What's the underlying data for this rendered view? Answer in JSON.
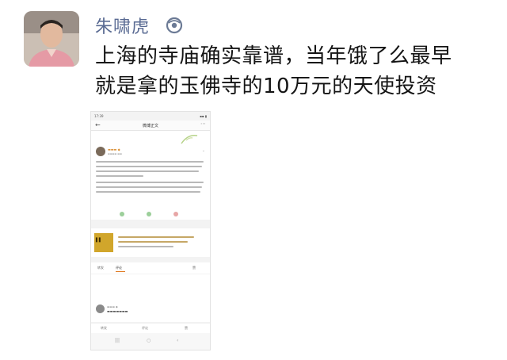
{
  "post": {
    "author": "朱啸虎",
    "lines": [
      "上海的寺庙确实靠谱，当年饿了么最早",
      "就是拿的玉佛寺的10万元的天使投资"
    ]
  },
  "embedded_screenshot": {
    "status_time": "17:39",
    "nav_title": "微博正文",
    "toolbar": [
      "转发",
      "评论",
      "赞"
    ],
    "tabs": [
      "转发",
      "评论",
      "赞"
    ]
  },
  "colors": {
    "author_name": "#5a6b93",
    "accent_orange": "#e07b24",
    "text_dark": "#141414"
  }
}
